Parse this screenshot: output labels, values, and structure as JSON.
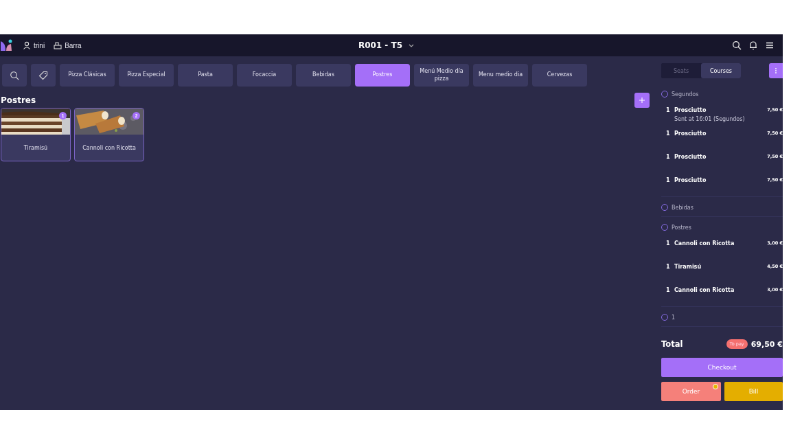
{
  "header": {
    "user": "trini",
    "location": "Barra",
    "title": "R001 - T5"
  },
  "categories": [
    {
      "label": "Pizza Clásicas",
      "selected": false
    },
    {
      "label": "Pizza Especial",
      "selected": false
    },
    {
      "label": "Pasta",
      "selected": false
    },
    {
      "label": "Focaccia",
      "selected": false
    },
    {
      "label": "Bebidas",
      "selected": false
    },
    {
      "label": "Postres",
      "selected": true
    },
    {
      "label": "Menú Medio día pizza",
      "selected": false
    },
    {
      "label": "Menu medio dia",
      "selected": false
    },
    {
      "label": "Cervezas",
      "selected": false
    }
  ],
  "section_title": "Postres",
  "products": [
    {
      "name": "Tiramisú",
      "badge": "1",
      "kind": "picture"
    },
    {
      "name": "Cannoli con Ricotta",
      "badge": "2",
      "kind": "picture"
    }
  ],
  "panel": {
    "tabs": [
      {
        "label": "Seats",
        "selected": false
      },
      {
        "label": "Courses",
        "selected": true
      }
    ],
    "groups": [
      {
        "name": "Segundos",
        "selected": false,
        "items": [
          {
            "qty": "1",
            "name": "Prosciutto",
            "note": "Sent at 16:01 (Segundos)",
            "price": "7,50 €"
          },
          {
            "qty": "1",
            "name": "Prosciutto",
            "price": "7,50 €"
          },
          {
            "qty": "1",
            "name": "Prosciutto",
            "price": "7,50 €"
          },
          {
            "qty": "1",
            "name": "Prosciutto",
            "price": "7,50 €"
          }
        ]
      },
      {
        "name": "Bebidas",
        "selected": false
      },
      {
        "name": "Postres",
        "selected": false,
        "items": [
          {
            "qty": "1",
            "name": "Cannoli con Ricotta",
            "price": "3,00 €"
          },
          {
            "qty": "1",
            "name": "Tiramisú",
            "price": "4,50 €"
          },
          {
            "qty": "1",
            "name": "Cannoli con Ricotta",
            "price": "3,00 €"
          }
        ]
      },
      {
        "name": "1",
        "selected": false
      }
    ],
    "total": {
      "label": "Total",
      "badge": "To pay",
      "amount": "69,50 €"
    },
    "actions": [
      {
        "label": "Checkout",
        "kind": "checkout"
      },
      {
        "label": "Order",
        "kind": "order",
        "notification": true
      },
      {
        "label": "Bill",
        "kind": "bill"
      }
    ]
  }
}
